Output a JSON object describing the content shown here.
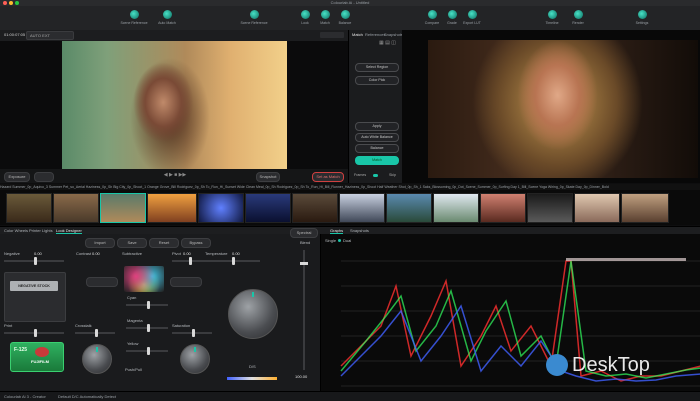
{
  "window": {
    "title": "Colourlab Ai - Untitled"
  },
  "toolbar": {
    "items": [
      {
        "label": "Scene Reference",
        "icon": "clapper-icon"
      },
      {
        "label": "Auto Match",
        "icon": "target-icon"
      },
      {
        "label": "Scene Reference",
        "icon": "layers-icon"
      },
      {
        "label": "Look",
        "icon": "palette-icon"
      },
      {
        "label": "Match",
        "icon": "match-icon"
      },
      {
        "label": "Balance",
        "icon": "balance-icon"
      },
      {
        "label": "Compare",
        "icon": "compare-icon"
      },
      {
        "label": "Grade",
        "icon": "grade-icon"
      },
      {
        "label": "Export LUT",
        "icon": "export-icon"
      },
      {
        "label": "Timeline",
        "icon": "timeline-icon"
      },
      {
        "label": "Render",
        "icon": "render-icon"
      },
      {
        "label": "Settings",
        "icon": "gear-icon"
      }
    ]
  },
  "viewer_left": {
    "timecode": "01:00:07:05",
    "mode": "AUTO EXT",
    "left_btn": "Exposure",
    "right_btn1": "Snapshot",
    "right_btn2": "Set as Match"
  },
  "match_panel": {
    "tabs": [
      "Match",
      "References",
      "Snapshots"
    ],
    "buttons": [
      "Select Region",
      "Color Pick",
      "Apply",
      "Auto White Balance",
      "Balance",
      "Match"
    ],
    "footer_left": "Frames",
    "footer_right": "Skip"
  },
  "filmstrip": {
    "names": "Hazard Summer_0p_Aquivo_3 Summer Pet_so_Aerial Haziness_0p_Sh Big City_0p_Shoot_1 Orange Grove_Bill Rodriguez_0p_Sh To_Run_Hi_Sunset Wide Clean Meal_0p_Sh Rodriguez_0p_Sh To_Run_Hi_Bill_Runner_Haziness_0p_Shoot Half Weather Shot_0p_Sh_1 Saks_Blossoming_0p_Dot_Scene_Summer_0p_Surfing Day 1_Bill_Scene Yoga Wiring_0p_Skate Day_0p_Dinner_Bold"
  },
  "lower_tabs": [
    "Color Wheels",
    "Printer Lights",
    "Look Designer"
  ],
  "panel": {
    "buttons": [
      "Import",
      "Save",
      "Reset",
      "Bypass"
    ],
    "labels": [
      "Negative",
      "Contrast",
      "Subtractive",
      "Pivot",
      "Temperature",
      "Print",
      "Crosstalk",
      "Magenta",
      "Saturation",
      "Cyan",
      "Yellow",
      "Push/Pull",
      "Blend",
      "Spectral"
    ],
    "values": {
      "negative": "0.00",
      "contrast": "0.00",
      "pivot": "0.00",
      "temperature": "0.00",
      "strength": "100.00"
    },
    "film_stock": "NEGATIVE STOCK",
    "print_stock": "FUJIFILM",
    "print_code": "F-125",
    "dial_label": "D/S"
  },
  "scope": {
    "tabs": [
      "Graphs",
      "Snapshots"
    ],
    "modes": [
      "Single",
      "Dual"
    ]
  },
  "status": {
    "left": "Colourlab Ai 3 - Creator",
    "center": "Default D/C Automatically Detect"
  },
  "watermark": {
    "text": "DeskTop"
  }
}
